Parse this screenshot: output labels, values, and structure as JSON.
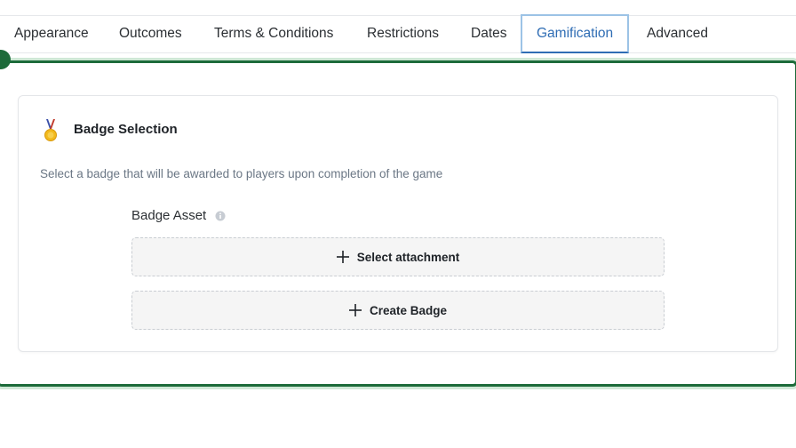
{
  "tabs": [
    {
      "label": "Appearance"
    },
    {
      "label": "Outcomes"
    },
    {
      "label": "Terms & Conditions"
    },
    {
      "label": "Restrictions"
    },
    {
      "label": "Dates"
    },
    {
      "label": "Gamification",
      "active": true
    },
    {
      "label": "Advanced"
    }
  ],
  "badge_section": {
    "icon": "medal-icon",
    "title": "Badge Selection",
    "description": "Select a badge that will be awarded to players upon completion of the game",
    "field_label": "Badge Asset",
    "info_icon": "info-icon",
    "select_attachment_label": "Select attachment",
    "create_badge_label": "Create Badge"
  },
  "colors": {
    "active_tab": "#2f6db4",
    "panel_border": "#1d6b3a",
    "description_text": "#6b7785"
  }
}
